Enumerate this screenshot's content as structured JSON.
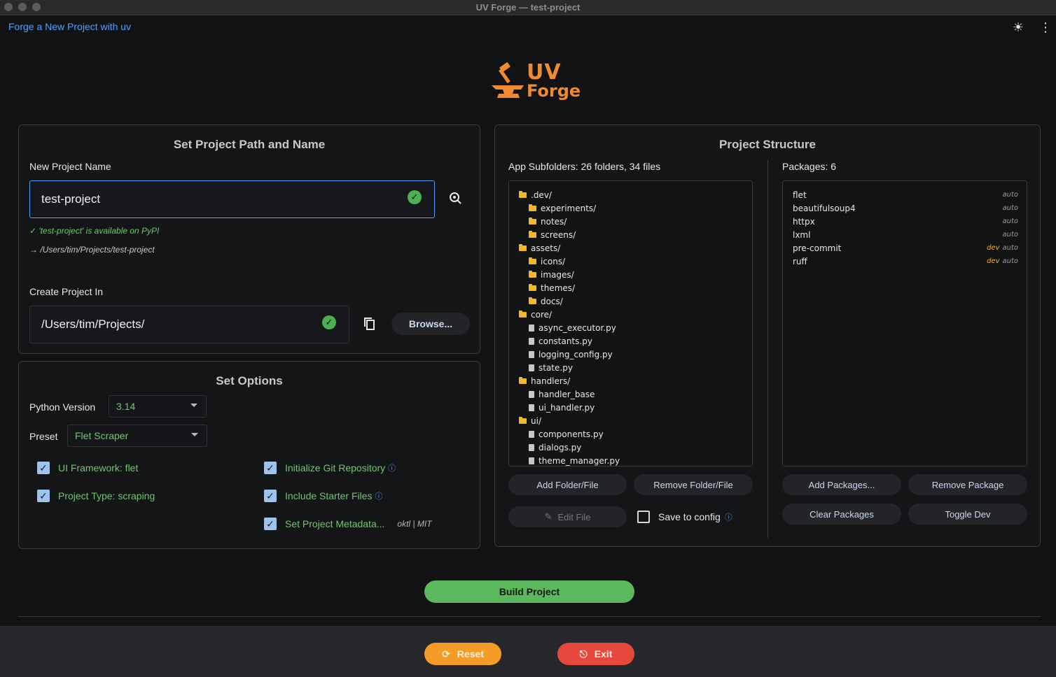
{
  "window": {
    "title": "UV Forge — test-project"
  },
  "appbar": {
    "title": "Forge a New Project with uv",
    "theme_icon": "sun-icon",
    "menu_icon": "more-vert-icon"
  },
  "logo": {
    "line1": "UV",
    "line2": "Forge"
  },
  "path_panel": {
    "title": "Set Project Path and Name",
    "name_label": "New Project Name",
    "name_value": "test-project",
    "available_hint": "✓ 'test-project' is available on PyPI",
    "path_hint": "→ /Users/tim/Projects/test-project",
    "location_label": "Create Project In",
    "location_value": "/Users/tim/Projects/",
    "browse_label": "Browse..."
  },
  "options_panel": {
    "title": "Set Options",
    "python_label": "Python Version",
    "python_value": "3.14",
    "preset_label": "Preset",
    "preset_value": "Flet Scraper",
    "checks": {
      "ui_framework": "UI Framework: flet",
      "project_type": "Project Type: scraping",
      "git": "Initialize Git Repository",
      "starter": "Include Starter Files",
      "metadata": "Set Project Metadata...",
      "metadata_value": "oktl | MIT"
    }
  },
  "structure_panel": {
    "title": "Project Structure",
    "subfolders_label": "App Subfolders: 26 folders, 34 files",
    "packages_label": "Packages: 6",
    "tree": [
      {
        "name": ".dev/",
        "kind": "folder",
        "depth": 0
      },
      {
        "name": "experiments/",
        "kind": "folder",
        "depth": 1
      },
      {
        "name": "notes/",
        "kind": "folder",
        "depth": 1
      },
      {
        "name": "screens/",
        "kind": "folder",
        "depth": 1
      },
      {
        "name": "assets/",
        "kind": "folder",
        "depth": 0
      },
      {
        "name": "icons/",
        "kind": "folder",
        "depth": 1
      },
      {
        "name": "images/",
        "kind": "folder",
        "depth": 1
      },
      {
        "name": "themes/",
        "kind": "folder",
        "depth": 1
      },
      {
        "name": "docs/",
        "kind": "folder",
        "depth": 1
      },
      {
        "name": "core/",
        "kind": "folder",
        "depth": 0
      },
      {
        "name": "async_executor.py",
        "kind": "file",
        "depth": 1
      },
      {
        "name": "constants.py",
        "kind": "file",
        "depth": 1
      },
      {
        "name": "logging_config.py",
        "kind": "file",
        "depth": 1
      },
      {
        "name": "state.py",
        "kind": "file",
        "depth": 1
      },
      {
        "name": "handlers/",
        "kind": "folder",
        "depth": 0
      },
      {
        "name": "handler_base",
        "kind": "file",
        "depth": 1
      },
      {
        "name": "ui_handler.py",
        "kind": "file",
        "depth": 1
      },
      {
        "name": "ui/",
        "kind": "folder",
        "depth": 0
      },
      {
        "name": "components.py",
        "kind": "file",
        "depth": 1
      },
      {
        "name": "dialogs.py",
        "kind": "file",
        "depth": 1
      },
      {
        "name": "theme_manager.py",
        "kind": "file",
        "depth": 1
      }
    ],
    "packages": [
      {
        "name": "flet",
        "dev": "",
        "tag": "auto"
      },
      {
        "name": "beautifulsoup4",
        "dev": "",
        "tag": "auto"
      },
      {
        "name": "httpx",
        "dev": "",
        "tag": "auto"
      },
      {
        "name": "lxml",
        "dev": "",
        "tag": "auto"
      },
      {
        "name": "pre-commit",
        "dev": "dev",
        "tag": "auto"
      },
      {
        "name": "ruff",
        "dev": "dev",
        "tag": "auto"
      }
    ],
    "buttons": {
      "add_folder": "Add Folder/File",
      "remove_folder": "Remove Folder/File",
      "edit_file": "Edit File",
      "save_config": "Save to config",
      "add_packages": "Add Packages...",
      "remove_package": "Remove Package",
      "clear_packages": "Clear Packages",
      "toggle_dev": "Toggle Dev"
    }
  },
  "actions": {
    "build": "Build Project",
    "reset": "Reset",
    "exit": "Exit"
  }
}
